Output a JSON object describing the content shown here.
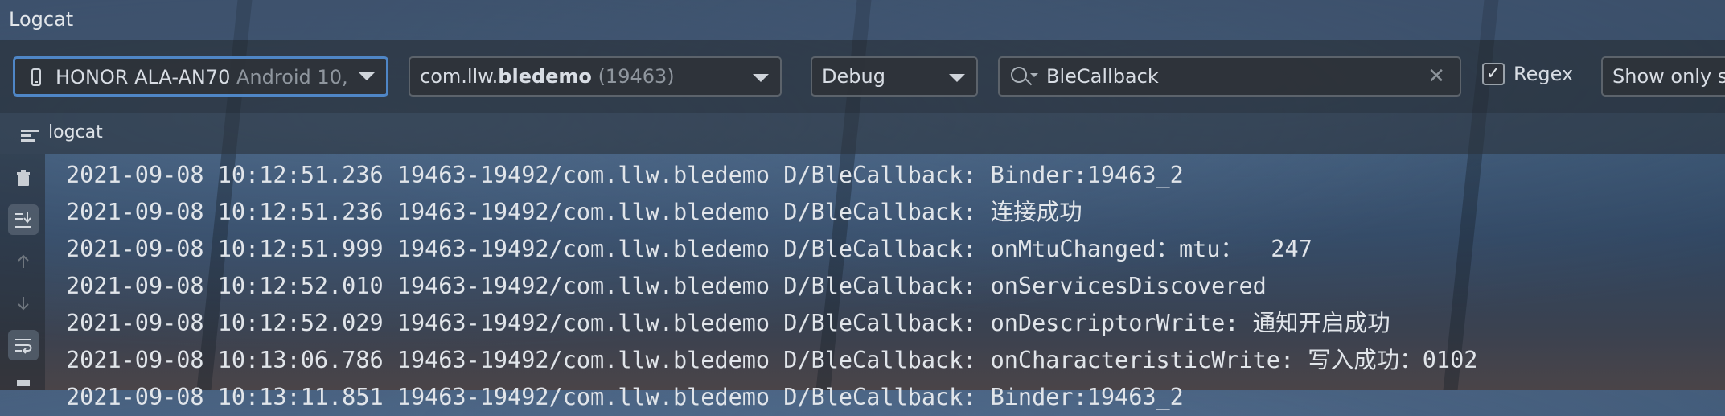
{
  "window": {
    "title": "Logcat"
  },
  "toolbar": {
    "device": {
      "name": "HONOR ALA-AN70",
      "detail": "Android 10,"
    },
    "process": {
      "prefix": "com.llw.",
      "bold": "bledemo",
      "pid": "(19463)"
    },
    "log_level": "Debug",
    "search": {
      "value": "BleCallback"
    },
    "regex": {
      "label": "Regex",
      "checked": true
    },
    "show_only": "Show only se"
  },
  "panel": {
    "tab_label": "logcat"
  },
  "sidebar": {
    "icons": [
      "trash-icon",
      "scroll-to-end-icon",
      "up-arrow-icon",
      "down-arrow-icon",
      "soft-wrap-icon",
      "print-icon"
    ]
  },
  "log_lines": [
    "2021-09-08 10:12:51.236 19463-19492/com.llw.bledemo D/BleCallback: Binder:19463_2",
    "2021-09-08 10:12:51.236 19463-19492/com.llw.bledemo D/BleCallback: 连接成功",
    "2021-09-08 10:12:51.999 19463-19492/com.llw.bledemo D/BleCallback: onMtuChanged：mtu：  247",
    "2021-09-08 10:12:52.010 19463-19492/com.llw.bledemo D/BleCallback: onServicesDiscovered",
    "2021-09-08 10:12:52.029 19463-19492/com.llw.bledemo D/BleCallback: onDescriptorWrite: 通知开启成功",
    "2021-09-08 10:13:06.786 19463-19492/com.llw.bledemo D/BleCallback: onCharacteristicWrite: 写入成功：0102",
    "2021-09-08 10:13:11.851 19463-19492/com.llw.bledemo D/BleCallback: Binder:19463_2"
  ],
  "colors": {
    "focus_border": "#4f86c6",
    "toolbar_bg": "#262c34",
    "text": "#e1e5ea"
  }
}
